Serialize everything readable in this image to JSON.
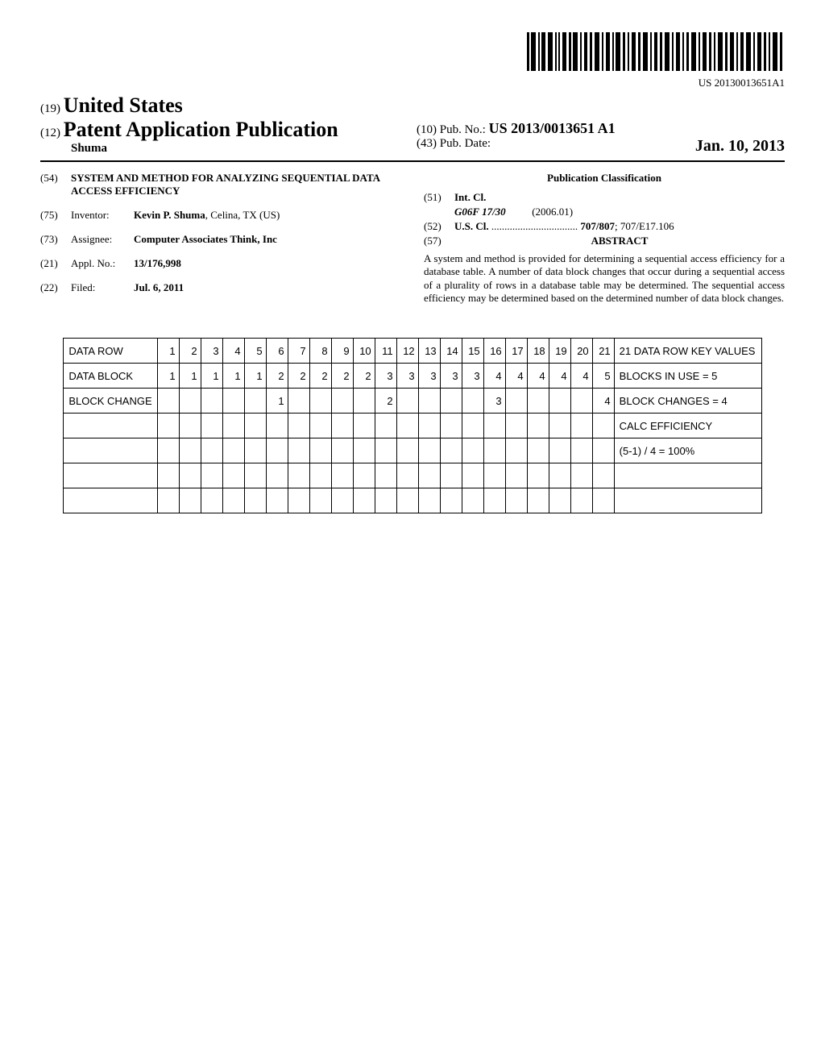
{
  "barcode_number": "US 20130013651A1",
  "header": {
    "code_19": "(19)",
    "country": "United States",
    "code_12": "(12)",
    "pub_type": "Patent Application Publication",
    "author": "Shuma",
    "code_10": "(10)",
    "pubno_label": "Pub. No.:",
    "pubno_value": "US 2013/0013651 A1",
    "code_43": "(43)",
    "pubdate_label": "Pub. Date:",
    "pubdate_value": "Jan. 10, 2013"
  },
  "left": {
    "title_code": "(54)",
    "title": "SYSTEM AND METHOD FOR ANALYZING SEQUENTIAL DATA ACCESS EFFICIENCY",
    "inventor_code": "(75)",
    "inventor_label": "Inventor:",
    "inventor_value": "Kevin P. Shuma",
    "inventor_loc": ", Celina, TX (US)",
    "assignee_code": "(73)",
    "assignee_label": "Assignee:",
    "assignee_value": "Computer Associates Think, Inc",
    "applno_code": "(21)",
    "applno_label": "Appl. No.:",
    "applno_value": "13/176,998",
    "filed_code": "(22)",
    "filed_label": "Filed:",
    "filed_value": "Jul. 6, 2011"
  },
  "right": {
    "pub_class_hdr": "Publication Classification",
    "intcl_code": "(51)",
    "intcl_label": "Int. Cl.",
    "intcl_class": "G06F 17/30",
    "intcl_date": "(2006.01)",
    "uscl_code": "(52)",
    "uscl_label": "U.S. Cl.",
    "uscl_value": "707/807",
    "uscl_value2": "; 707/E17.106",
    "abstract_code": "(57)",
    "abstract_hdr": "ABSTRACT",
    "abstract_text": "A system and method is provided for determining a sequential access efficiency for a database table. A number of data block changes that occur during a sequential access of a plurality of rows in a database table may be determined. The sequential access efficiency may be determined based on the determined number of data block changes."
  },
  "chart_data": {
    "type": "table",
    "columns": 21,
    "rows": [
      {
        "label": "DATA ROW",
        "values": [
          "1",
          "2",
          "3",
          "4",
          "5",
          "6",
          "7",
          "8",
          "9",
          "10",
          "11",
          "12",
          "13",
          "14",
          "15",
          "16",
          "17",
          "18",
          "19",
          "20",
          "21"
        ],
        "note": "21 DATA ROW KEY VALUES"
      },
      {
        "label": "DATA BLOCK",
        "values": [
          "1",
          "1",
          "1",
          "1",
          "1",
          "2",
          "2",
          "2",
          "2",
          "2",
          "3",
          "3",
          "3",
          "3",
          "3",
          "4",
          "4",
          "4",
          "4",
          "4",
          "5"
        ],
        "note": "BLOCKS IN USE = 5"
      },
      {
        "label": "BLOCK CHANGE",
        "values": [
          "",
          "",
          "",
          "",
          "",
          "1",
          "",
          "",
          "",
          "",
          "2",
          "",
          "",
          "",
          "",
          "3",
          "",
          "",
          "",
          "",
          "4"
        ],
        "note": "BLOCK CHANGES = 4"
      },
      {
        "label": "",
        "values": [
          "",
          "",
          "",
          "",
          "",
          "",
          "",
          "",
          "",
          "",
          "",
          "",
          "",
          "",
          "",
          "",
          "",
          "",
          "",
          "",
          ""
        ],
        "note": "CALC EFFICIENCY"
      },
      {
        "label": "",
        "values": [
          "",
          "",
          "",
          "",
          "",
          "",
          "",
          "",
          "",
          "",
          "",
          "",
          "",
          "",
          "",
          "",
          "",
          "",
          "",
          "",
          ""
        ],
        "note": "(5-1) /  4 = 100%"
      },
      {
        "label": "",
        "values": [
          "",
          "",
          "",
          "",
          "",
          "",
          "",
          "",
          "",
          "",
          "",
          "",
          "",
          "",
          "",
          "",
          "",
          "",
          "",
          "",
          ""
        ],
        "note": ""
      },
      {
        "label": "",
        "values": [
          "",
          "",
          "",
          "",
          "",
          "",
          "",
          "",
          "",
          "",
          "",
          "",
          "",
          "",
          "",
          "",
          "",
          "",
          "",
          "",
          ""
        ],
        "note": ""
      }
    ]
  }
}
